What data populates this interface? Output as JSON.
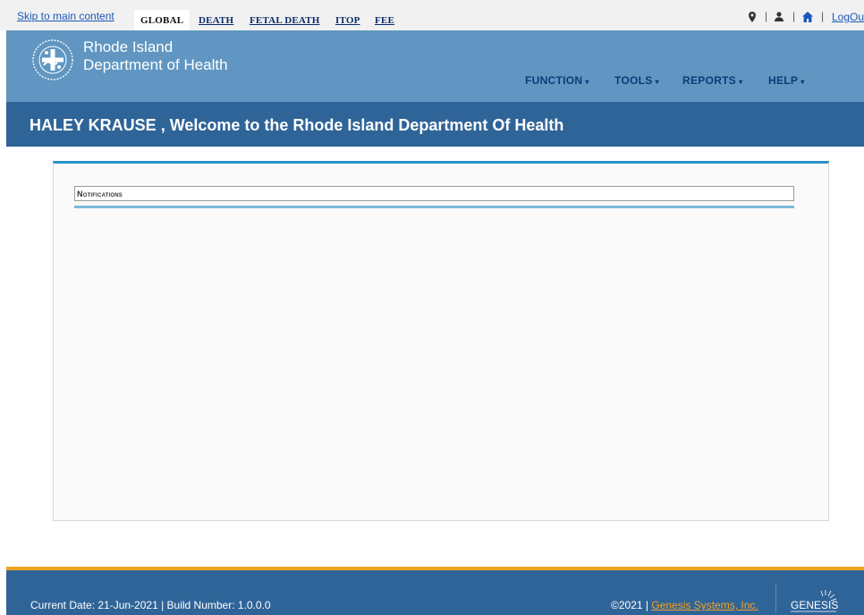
{
  "top_bar": {
    "skip_link": "Skip to main content",
    "tabs": [
      "GLOBAL",
      "DEATH",
      "FETAL DEATH",
      "ITOP",
      "FEE"
    ],
    "active_tab": "GLOBAL",
    "separator": "|",
    "logout": "LogOut"
  },
  "header": {
    "brand_line1": "Rhode Island",
    "brand_line2": "Department of Health",
    "menu": [
      "FUNCTION",
      "TOOLS",
      "REPORTS",
      "HELP"
    ]
  },
  "welcome": {
    "text": "HALEY KRAUSE , Welcome to the Rhode Island Department Of Health"
  },
  "main": {
    "notifications_title": "Notifications"
  },
  "footer": {
    "left_text": "Current Date: 21-Jun-2021 | Build Number: 1.0.0.0",
    "copyright": "©2021 |",
    "company_link": "Genesis Systems, Inc.",
    "logo_text": "GENESIS"
  },
  "colors": {
    "header_bg": "#6096c1",
    "welcome_bg": "#2f6498",
    "footer_accent": "#efa21c",
    "panel_accent": "#2a93c9"
  },
  "icons": [
    "map-marker-icon",
    "user-icon",
    "home-icon",
    "seal-logo",
    "genesis-logo"
  ]
}
